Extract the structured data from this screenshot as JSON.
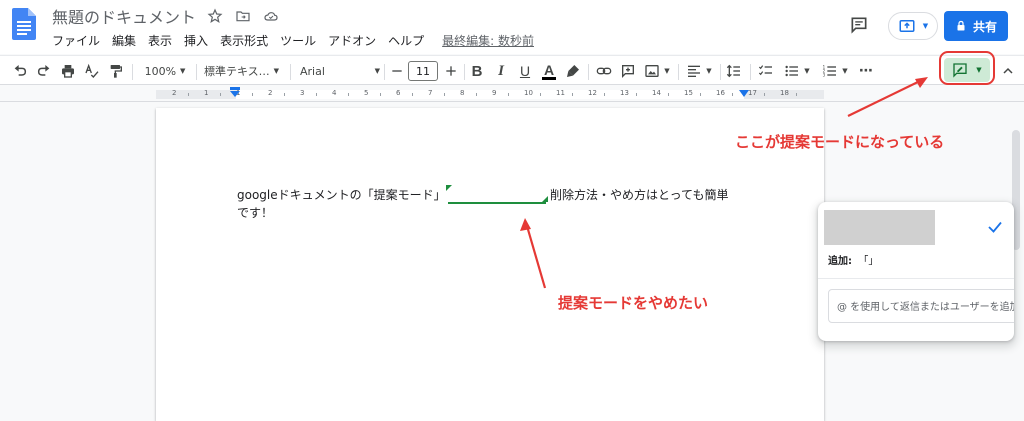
{
  "header": {
    "doc_title": "無題のドキュメント",
    "menu": [
      "ファイル",
      "編集",
      "表示",
      "挿入",
      "表示形式",
      "ツール",
      "アドオン",
      "ヘルプ"
    ],
    "last_edit": "最終編集: 数秒前",
    "share_label": "共有"
  },
  "toolbar": {
    "zoom": "100%",
    "style": "標準テキス…",
    "font": "Arial",
    "font_size": "11",
    "bold": "B",
    "italic": "I",
    "underline": "U",
    "text_color_letter": "A",
    "more": "⋯"
  },
  "ruler": {
    "numbers": [
      "2",
      "1",
      "1",
      "2",
      "3",
      "4",
      "5",
      "6",
      "7",
      "8",
      "9",
      "10",
      "11",
      "12",
      "13",
      "14",
      "15",
      "16",
      "17",
      "18"
    ]
  },
  "document": {
    "line1_before": "googleドキュメントの「提案モード」",
    "line1_after": "削除方法・やめ方はとっても簡単",
    "line2": "です！"
  },
  "comment": {
    "add_label": "追加:",
    "add_value": "「」",
    "reply_placeholder": "@ を使用して返信またはユーザーを追加"
  },
  "annotations": {
    "top": "ここが提案モードになっている",
    "bottom": "提案モードをやめたい"
  },
  "colors": {
    "share": "#1a73e8",
    "suggest_green": "#1e8e3e",
    "annotation_red": "#e53935"
  }
}
